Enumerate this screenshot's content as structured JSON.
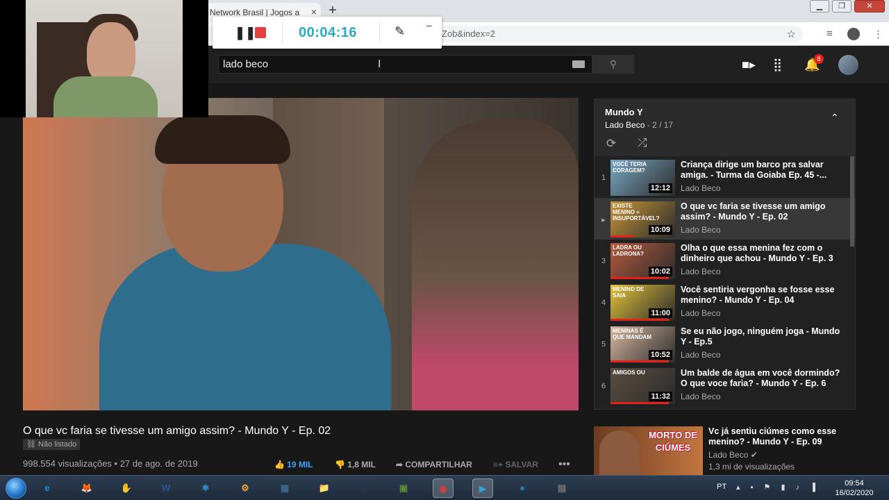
{
  "browser": {
    "tab_title": "Network Brasil | Jogos a",
    "tab_close": "×",
    "new_tab": "+",
    "url": "Zob&index=2",
    "window_controls": [
      "▁",
      "❐",
      "✕"
    ]
  },
  "recorder": {
    "timer": "00:04:16",
    "pause_glyph": "❚❚",
    "pen_glyph": "✎",
    "minimize_glyph": "–"
  },
  "youtube": {
    "search_value": "lado beco",
    "notifications_count": "8"
  },
  "video": {
    "title": "O que vc faria se tivesse um amigo assim? - Mundo Y - Ep. 02",
    "unlisted_label": "Não listado",
    "views_date": "998.554 visualizações • 27 de ago. de 2019",
    "likes": "19 MIL",
    "dislikes": "1,8 MIL",
    "share_label": "COMPARTILHAR",
    "save_label": "SALVAR",
    "more_glyph": "•••"
  },
  "playlist": {
    "name": "Mundo Y",
    "channel": "Lado Beco",
    "position": " - 2 / 17",
    "items": [
      {
        "index": "1",
        "title": "Criança dirige um barco pra salvar amiga. - Turma da Goiaba Ep. 45 -...",
        "channel": "Lado Beco",
        "duration": "12:12",
        "thumb_text": "VOCÊ TERIA CORAGEM?",
        "progress": 0
      },
      {
        "index": "▸",
        "title": "O que vc faria se tivesse um amigo assim? - Mundo Y - Ep. 02",
        "channel": "Lado Beco",
        "duration": "10:09",
        "thumb_text": "EXISTE MENINO + INSUPORTÁVEL?",
        "progress": 0.35
      },
      {
        "index": "3",
        "title": "Olha o que essa menina fez com o dinheiro que achou - Mundo Y - Ep. 3",
        "channel": "Lado Beco",
        "duration": "10:02",
        "thumb_text": "LADRA OU LADRONA?",
        "progress": 0.9
      },
      {
        "index": "4",
        "title": "Você sentiria vergonha se fosse esse menino? - Mundo Y - Ep. 04",
        "channel": "Lado Beco",
        "duration": "11:00",
        "thumb_text": "MENINO DE SAIA",
        "progress": 0.9
      },
      {
        "index": "5",
        "title": "Se eu não jogo, ninguém joga - Mundo Y - Ep.5",
        "channel": "Lado Beco",
        "duration": "10:52",
        "thumb_text": "MENINAS É QUE MANDAM",
        "progress": 0.9
      },
      {
        "index": "6",
        "title": "Um balde de água em você dormindo? O que voce faria? - Mundo Y - Ep. 6",
        "channel": "Lado Beco",
        "duration": "11:32",
        "thumb_text": "AMIGOS OU",
        "progress": 0.9
      }
    ]
  },
  "recommended": {
    "title": "Vc já sentiu ciúmes como esse menino? - Mundo Y - Ep. 09",
    "channel": "Lado Beco",
    "views": "1,3 mi de visualizações",
    "thumb_text": "MORTO DE CIÚMES"
  },
  "taskbar": {
    "lang": "PT",
    "time": "09:54",
    "date": "16/02/2020",
    "apps": [
      "e",
      "🦊",
      "✋",
      "W",
      "⚛",
      "⚙",
      "▦",
      "📁",
      "♨",
      "▣",
      "◉",
      "▶",
      "●",
      "▤"
    ]
  },
  "colors": {
    "accent_blue": "#3ea6ff",
    "youtube_red": "#e62117",
    "timer_blue": "#2aa7c9"
  }
}
